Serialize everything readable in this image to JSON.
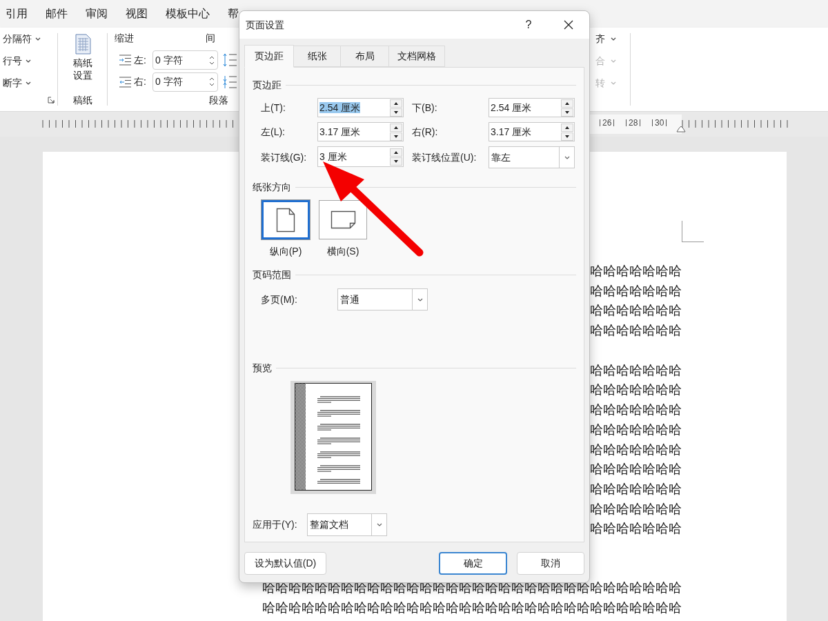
{
  "menu_tabs": [
    {
      "label": "引用"
    },
    {
      "label": "邮件"
    },
    {
      "label": "审阅"
    },
    {
      "label": "视图"
    },
    {
      "label": "模板中心"
    },
    {
      "label": "帮"
    }
  ],
  "ribbon": {
    "break_items": [
      {
        "label": "分隔符"
      },
      {
        "label": "行号"
      },
      {
        "label": "断字"
      }
    ],
    "paper_group": {
      "button": "稿纸设置",
      "label": "稿纸"
    },
    "paragraph_group": {
      "indent_title": "缩进",
      "indent_rows": [
        {
          "kind": "left",
          "label": "左:",
          "value": "0 字符"
        },
        {
          "kind": "right",
          "label": "右:",
          "value": "0 字符"
        }
      ],
      "spacing_title": "间",
      "label": "段落"
    },
    "arrange_items": [
      {
        "label": "齐",
        "disabled": false
      },
      {
        "label": "合",
        "disabled": true
      },
      {
        "label": "转",
        "disabled": true
      }
    ]
  },
  "ruler": {
    "labels": [
      "26",
      "28",
      "30"
    ]
  },
  "document": {
    "blocks": [
      {
        "lines": [
          "哈哈哈哈哈哈哈",
          "哈哈哈哈哈哈哈",
          "哈哈哈哈哈哈哈",
          "哈哈哈哈哈哈哈"
        ]
      },
      {
        "lines": [
          "哈哈哈哈哈哈哈",
          "哈哈哈哈哈哈哈",
          "哈哈哈哈哈哈哈",
          "哈哈哈哈哈哈哈",
          "哈哈哈哈哈哈哈",
          "哈哈哈哈哈哈哈",
          "哈哈哈哈哈哈哈",
          "哈哈哈哈哈哈哈",
          "哈哈哈哈哈哈哈"
        ]
      },
      {
        "lines": [
          "哈哈哈哈哈哈哈哈哈哈哈哈哈哈哈哈哈哈哈哈哈哈哈哈哈哈哈哈哈哈哈哈",
          "哈哈哈哈哈哈哈哈哈哈哈哈哈哈哈哈哈哈哈哈哈哈哈哈哈哈哈哈哈哈哈哈"
        ]
      }
    ]
  },
  "dialog": {
    "title": "页面设置",
    "help": "?",
    "tabs": [
      {
        "label": "页边距",
        "selected": true
      },
      {
        "label": "纸张",
        "selected": false
      },
      {
        "label": "布局",
        "selected": false
      },
      {
        "label": "文档网格",
        "selected": false
      }
    ],
    "margins": {
      "title": "页边距",
      "fields": [
        {
          "kind": "spin",
          "label": "上(T):",
          "value": "2.54 厘米",
          "text_selected": true
        },
        {
          "kind": "spin",
          "label": "下(B):",
          "value": "2.54 厘米",
          "text_selected": false
        },
        {
          "kind": "spin",
          "label": "左(L):",
          "value": "3.17 厘米",
          "text_selected": false
        },
        {
          "kind": "spin",
          "label": "右(R):",
          "value": "3.17 厘米",
          "text_selected": false
        },
        {
          "kind": "spin",
          "label": "装订线(G):",
          "value": "3 厘米",
          "text_selected": false
        },
        {
          "kind": "dropdown",
          "label": "装订线位置(U):",
          "value": "靠左"
        }
      ]
    },
    "orientation": {
      "title": "纸张方向",
      "options": [
        {
          "kind": "portrait",
          "label": "纵向(P)",
          "selected": true
        },
        {
          "kind": "landscape",
          "label": "横向(S)",
          "selected": false
        }
      ]
    },
    "pages": {
      "title": "页码范围",
      "label": "多页(M):",
      "value": "普通"
    },
    "preview": {
      "title": "预览"
    },
    "apply": {
      "label": "应用于(Y):",
      "value": "整篇文档"
    },
    "buttons": [
      {
        "kind": "secondary",
        "label": "设为默认值(D)"
      },
      {
        "kind": "default",
        "label": "确定"
      },
      {
        "kind": "secondary",
        "label": "取消"
      }
    ]
  }
}
